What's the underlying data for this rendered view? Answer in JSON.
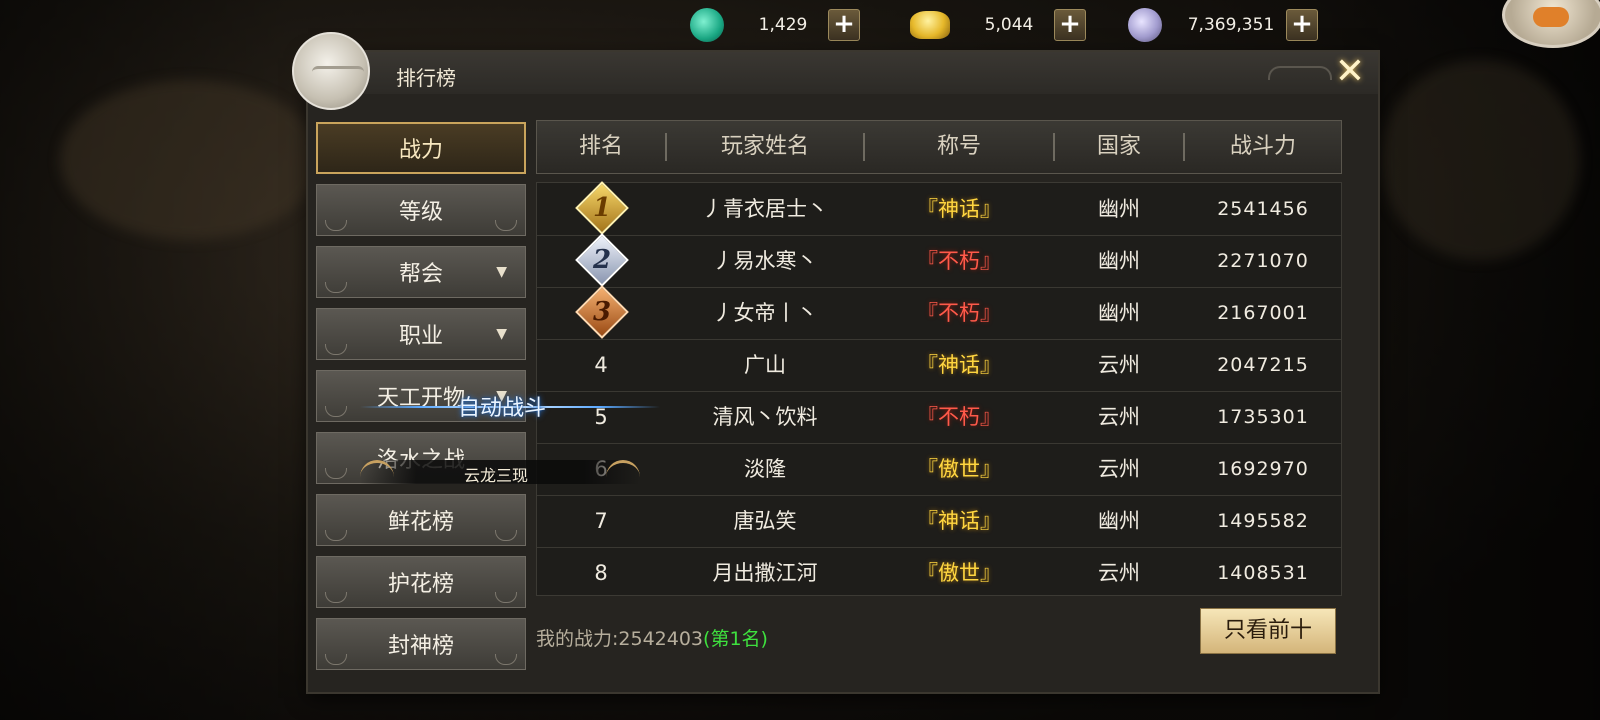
{
  "currencies": [
    {
      "icon": "jade-coin-icon",
      "value": "1,429"
    },
    {
      "icon": "gold-ingot-icon",
      "value": "5,044"
    },
    {
      "icon": "silver-coin-icon",
      "value": "7,369,351"
    }
  ],
  "add_label": "+",
  "panel": {
    "title": "排行榜",
    "close_label": "✕"
  },
  "sidebar": {
    "items": [
      {
        "label": "战力",
        "active": true,
        "dropdown": false
      },
      {
        "label": "等级",
        "active": false,
        "dropdown": false
      },
      {
        "label": "帮会",
        "active": false,
        "dropdown": true
      },
      {
        "label": "职业",
        "active": false,
        "dropdown": true
      },
      {
        "label": "天工开物",
        "active": false,
        "dropdown": true
      },
      {
        "label": "洛水之战",
        "active": false,
        "dropdown": false
      },
      {
        "label": "鲜花榜",
        "active": false,
        "dropdown": false
      },
      {
        "label": "护花榜",
        "active": false,
        "dropdown": false
      },
      {
        "label": "封神榜",
        "active": false,
        "dropdown": false
      }
    ],
    "dropdown_glyph": "▼"
  },
  "table": {
    "headers": [
      "排名",
      "玩家姓名",
      "称号",
      "国家",
      "战斗力"
    ],
    "rows": [
      {
        "rank": "1",
        "name": "丿青衣居士丶",
        "title": "『神话』",
        "title_color": "gold",
        "country": "幽州",
        "power": "2541456"
      },
      {
        "rank": "2",
        "name": "丿易水寒丶",
        "title": "『不朽』",
        "title_color": "red",
        "country": "幽州",
        "power": "2271070"
      },
      {
        "rank": "3",
        "name": "丿女帝丨丶",
        "title": "『不朽』",
        "title_color": "red",
        "country": "幽州",
        "power": "2167001"
      },
      {
        "rank": "4",
        "name": "广山",
        "title": "『神话』",
        "title_color": "gold",
        "country": "云州",
        "power": "2047215"
      },
      {
        "rank": "5",
        "name": "清风丶饮料",
        "title": "『不朽』",
        "title_color": "red",
        "country": "云州",
        "power": "1735301"
      },
      {
        "rank": "6",
        "name": "淡隆",
        "title": "『傲世』",
        "title_color": "gold",
        "country": "云州",
        "power": "1692970"
      },
      {
        "rank": "7",
        "name": "唐弘笑",
        "title": "『神话』",
        "title_color": "gold",
        "country": "幽州",
        "power": "1495582"
      },
      {
        "rank": "8",
        "name": "月出撒江河",
        "title": "『傲世』",
        "title_color": "gold",
        "country": "云州",
        "power": "1408531"
      }
    ]
  },
  "overlay": {
    "auto_fight": "自动战斗",
    "skill_name": "云龙三现"
  },
  "footer": {
    "my_power_label": "我的战力:",
    "my_power_value": "2542403",
    "my_rank": "(第1名)",
    "top10_button": "只看前十"
  },
  "colors": {
    "gold_title": "#ffd640",
    "red_title": "#ff5a4a",
    "rank_green": "#3ee03e",
    "active_border": "#c9a45c"
  }
}
